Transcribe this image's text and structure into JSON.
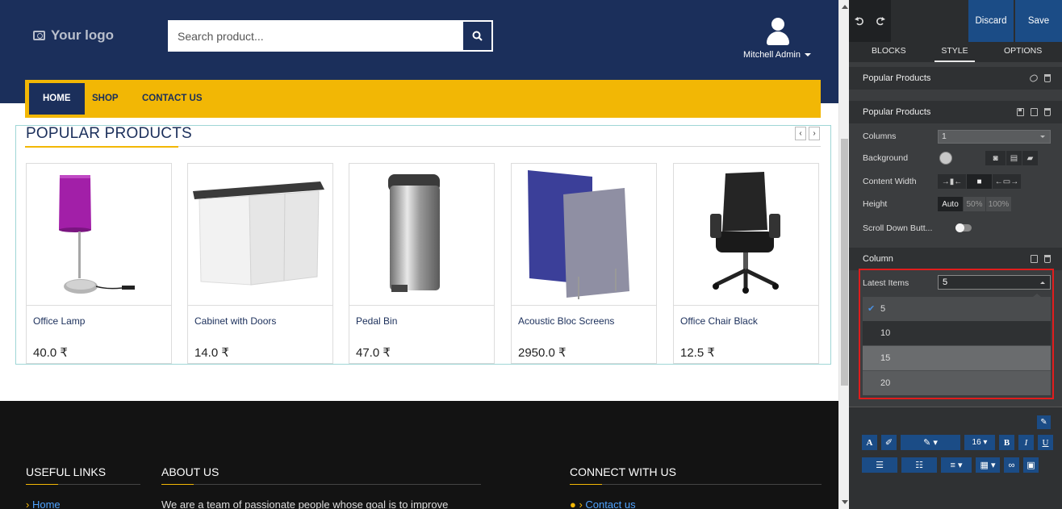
{
  "site": {
    "logo_text": "Your logo",
    "search_placeholder": "Search product...",
    "user_name": "Mitchell Admin",
    "nav": [
      "HOME",
      "SHOP",
      "CONTACT US"
    ],
    "section_title": "POPULAR PRODUCTS",
    "carousel_prev": "‹",
    "carousel_next": "›",
    "products": [
      {
        "name": "Office Lamp",
        "price": "40.0 ₹"
      },
      {
        "name": "Cabinet with Doors",
        "price": "14.0 ₹"
      },
      {
        "name": "Pedal Bin",
        "price": "47.0 ₹"
      },
      {
        "name": "Acoustic Bloc Screens",
        "price": "2950.0 ₹"
      },
      {
        "name": "Office Chair Black",
        "price": "12.5 ₹"
      }
    ],
    "footer": {
      "useful_links_title": "USEFUL LINKS",
      "useful_links_first": "Home",
      "about_title": "ABOUT US",
      "about_text": "We are a team of passionate people whose goal is to improve",
      "connect_title": "CONNECT WITH US",
      "connect_first": "Contact us"
    }
  },
  "panel": {
    "discard_label": "Discard",
    "save_label": "Save",
    "tabs": [
      "BLOCKS",
      "STYLE",
      "OPTIONS"
    ],
    "active_tab": "STYLE",
    "snippet_title": "Popular Products",
    "section_title": "Popular Products",
    "options": {
      "columns_label": "Columns",
      "columns_value": "1",
      "background_label": "Background",
      "content_width_label": "Content Width",
      "height_label": "Height",
      "height_options": [
        "Auto",
        "50%",
        "100%"
      ],
      "scroll_down_label": "Scroll Down Butt..."
    },
    "column_title": "Column",
    "latest_items_label": "Latest Items",
    "latest_items_value": "5",
    "latest_items_options": [
      "5",
      "10",
      "15",
      "20"
    ],
    "font_size_value": "16"
  },
  "colors": {
    "header_bg": "#1b2f5b",
    "nav_bg": "#f2b705",
    "panel_bg": "#3b3d3f",
    "button_blue": "#1b4c86",
    "highlight_red": "#e11d1d"
  }
}
